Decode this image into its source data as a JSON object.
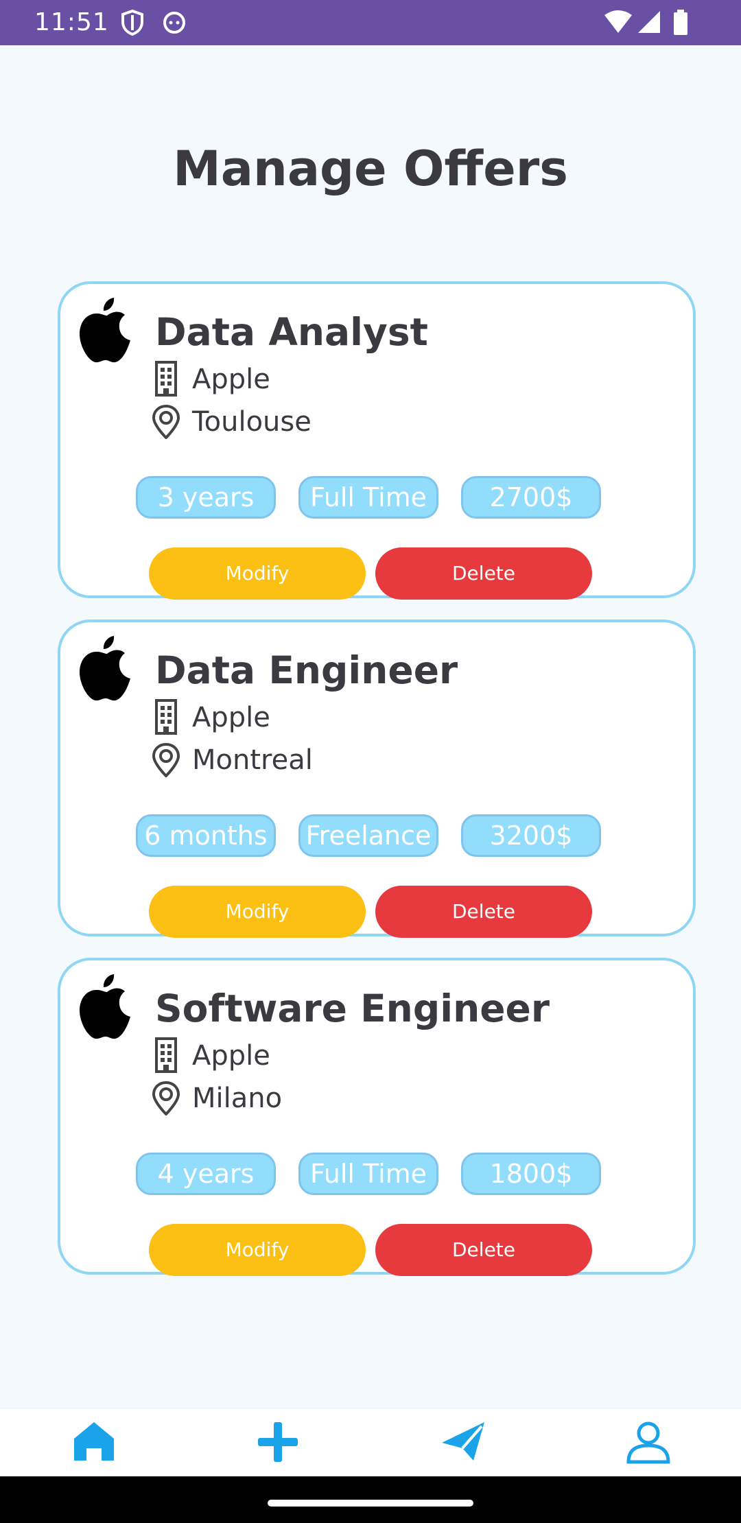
{
  "status_bar": {
    "time": "11:51",
    "icons": [
      "shield-icon",
      "cat-icon",
      "wifi-icon",
      "signal-icon",
      "battery-icon"
    ]
  },
  "page": {
    "title": "Manage Offers"
  },
  "colors": {
    "accent": "#8fd6f4",
    "chip_bg": "#92dcfc",
    "modify": "#fcbf14",
    "delete": "#e63a3f",
    "nav": "#1aa3e8",
    "status_bar": "#6a50a4"
  },
  "offers": [
    {
      "title": "Data Analyst",
      "company": "Apple",
      "location": "Toulouse",
      "duration": "3 years",
      "type": "Full Time",
      "salary": "2700$",
      "modify_label": "Modify",
      "delete_label": "Delete"
    },
    {
      "title": "Data Engineer",
      "company": "Apple",
      "location": "Montreal",
      "duration": "6 months",
      "type": "Freelance",
      "salary": "3200$",
      "modify_label": "Modify",
      "delete_label": "Delete"
    },
    {
      "title": "Software Engineer",
      "company": "Apple",
      "location": "Milano",
      "duration": "4 years",
      "type": "Full Time",
      "salary": "1800$",
      "modify_label": "Modify",
      "delete_label": "Delete"
    }
  ],
  "bottom_nav": {
    "items": [
      "home-icon",
      "add-icon",
      "send-icon",
      "profile-icon"
    ]
  }
}
